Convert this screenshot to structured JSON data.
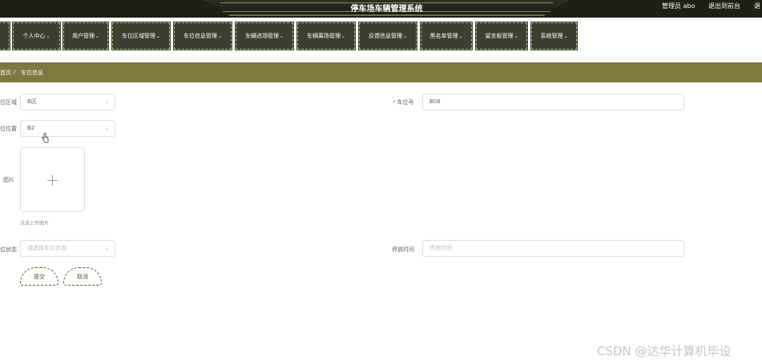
{
  "header": {
    "title": "停车场车辆管理系统",
    "user": "管理员 abo",
    "back_to_frontend": "退出到前台",
    "exit_partial": "退"
  },
  "nav": [
    {
      "label": "个人中心"
    },
    {
      "label": "用户管理"
    },
    {
      "label": "车位区域管理"
    },
    {
      "label": "车位信息管理"
    },
    {
      "label": "车辆进场管理"
    },
    {
      "label": "车辆离场管理"
    },
    {
      "label": "反馈信息管理"
    },
    {
      "label": "黑名单管理"
    },
    {
      "label": "留言板管理"
    },
    {
      "label": "系统管理"
    }
  ],
  "breadcrumb": {
    "home": "首页",
    "separator": "/",
    "current": "车位信息"
  },
  "form": {
    "area_label": "位区域",
    "area_value": "B区",
    "spot_number_label": "车位号",
    "spot_number_value": "B08",
    "spot_position_label": "位位置",
    "spot_position_value": "B2",
    "image_label": "图片",
    "upload_tip": "点击上传图片",
    "status_label": "位状态",
    "status_placeholder": "请选择车位状态",
    "parking_time_label": "停放时间",
    "parking_time_placeholder": "停放时间",
    "submit_label": "提交",
    "cancel_label": "取消"
  },
  "watermark": "CSDN @达华计算机毕设",
  "colors": {
    "header_bg": "#1c1f14",
    "nav_bg": "#3c3f30",
    "breadcrumb_bg": "#7d783f",
    "required": "#f56c6c"
  }
}
